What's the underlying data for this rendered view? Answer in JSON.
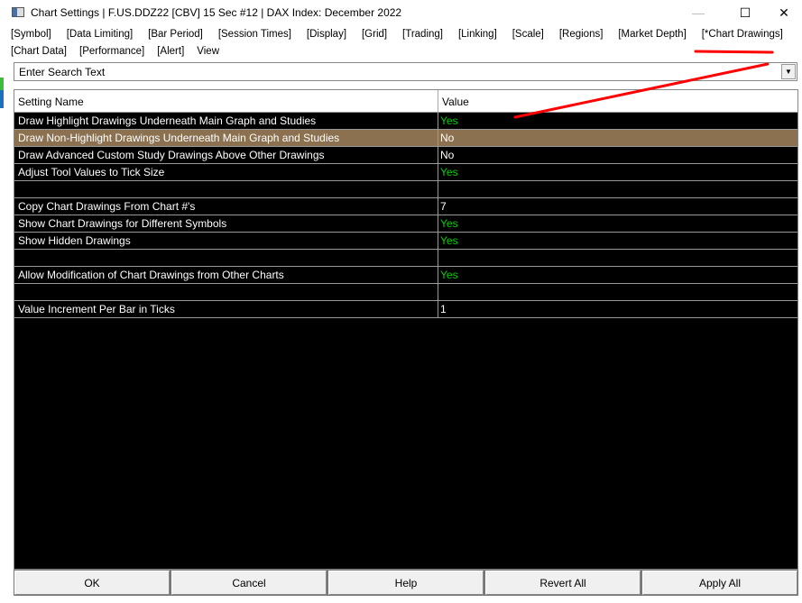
{
  "window": {
    "title": "Chart Settings | F.US.DDZ22 [CBV]  15 Sec   #12 | DAX Index: December 2022",
    "minimize": "—",
    "maximize": "☐",
    "close": "✕"
  },
  "menu_row1": [
    "[Symbol]",
    "[Data Limiting]",
    "[Bar Period]",
    "[Session Times]",
    "[Display]",
    "[Grid]",
    "[Trading]",
    "[Linking]",
    "[Scale]",
    "[Regions]",
    "[Market Depth]",
    "[*Chart Drawings]"
  ],
  "menu_row2": [
    "[Chart Data]",
    "[Performance]",
    "[Alert]",
    "View"
  ],
  "search": {
    "value": "Enter Search Text"
  },
  "table": {
    "headers": [
      "Setting Name",
      "Value"
    ],
    "rows": [
      {
        "name": "Draw Highlight Drawings Underneath Main Graph and Studies",
        "value": "Yes"
      },
      {
        "name": "Draw Non-Highlight Drawings Underneath Main Graph and Studies",
        "value": "No",
        "selected": true
      },
      {
        "name": "Draw Advanced Custom Study Drawings Above Other Drawings",
        "value": "No"
      },
      {
        "name": "Adjust Tool Values to Tick Size",
        "value": "Yes"
      },
      {
        "name": "",
        "value": ""
      },
      {
        "name": "Copy Chart Drawings From Chart #'s",
        "value": "7"
      },
      {
        "name": "Show Chart Drawings for Different Symbols",
        "value": "Yes"
      },
      {
        "name": "Show Hidden Drawings",
        "value": "Yes"
      },
      {
        "name": "",
        "value": ""
      },
      {
        "name": "Allow Modification of Chart Drawings from Other Charts",
        "value": "Yes"
      },
      {
        "name": "",
        "value": ""
      },
      {
        "name": "Value Increment Per Bar in Ticks",
        "value": "1"
      }
    ]
  },
  "buttons": [
    "OK",
    "Cancel",
    "Help",
    "Revert All",
    "Apply All"
  ],
  "colors": {
    "selected_row": "#8b7150",
    "yes": "#00d000",
    "annotation": "#ff0000"
  }
}
